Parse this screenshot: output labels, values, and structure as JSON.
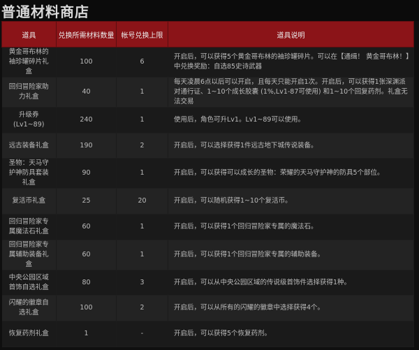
{
  "page_title": "普通材料商店",
  "table": {
    "headers": [
      "道具",
      "兑换所需材料数量",
      "帐号兑换上限",
      "道具说明"
    ],
    "rows": [
      {
        "name": "黄金哥布林的袖珍罐碎片礼盒",
        "cost": "100",
        "limit": "6",
        "desc": "开启后，可以获得5个黄金哥布林的袖珍罐碎片。可以在【通缉！ 黄金哥布林！】中兑换奖励：自选85史诗武器"
      },
      {
        "name": "回归冒险家助力礼盒",
        "cost": "40",
        "limit": "1",
        "desc": "每天凌晨6点以后可以开启，且每天只能开启1次。开启后，可以获得1张深渊派对通行证、1~10个成长胶囊 (1%,Lv1-87可使用) 和1~10个回复药剂。礼盒无法交易"
      },
      {
        "name": "升级券 (Lv1~89)",
        "cost": "240",
        "limit": "1",
        "desc": "使用后，角色可升Lv1。Lv1~89可以使用。"
      },
      {
        "name": "远古装备礼盒",
        "cost": "190",
        "limit": "2",
        "desc": "开启后，可以选择获得1件远古地下城传说装备。"
      },
      {
        "name": "圣物：天马守护神防具套装礼盒",
        "cost": "90",
        "limit": "1",
        "desc": "开启后，可以获得可以成长的圣物：荣耀的天马守护神的防具5个部位。"
      },
      {
        "name": "复活币礼盒",
        "cost": "25",
        "limit": "20",
        "desc": "开启后，可以随机获得1~10个复活币。"
      },
      {
        "name": "回归冒险家专属魔法石礼盒",
        "cost": "60",
        "limit": "1",
        "desc": "开启后，可以获得1个回归冒险家专属的魔法石。"
      },
      {
        "name": "回归冒险家专属辅助装备礼盒",
        "cost": "60",
        "limit": "1",
        "desc": "开启后，可以获得1个回归冒险家专属的辅助装备。"
      },
      {
        "name": "中央公园区域首饰自选礼盒",
        "cost": "80",
        "limit": "3",
        "desc": "开启后，可以从中央公园区域的传说级首饰件选择获得1种。"
      },
      {
        "name": "闪耀的徽章自选礼盒",
        "cost": "100",
        "limit": "2",
        "desc": "开启后，可以从所有的闪耀的徽章中选择获得4个。"
      },
      {
        "name": "恢复药剂礼盒",
        "cost": "1",
        "limit": "-",
        "desc": "开启后，可以获得5个恢复药剂。"
      }
    ]
  }
}
